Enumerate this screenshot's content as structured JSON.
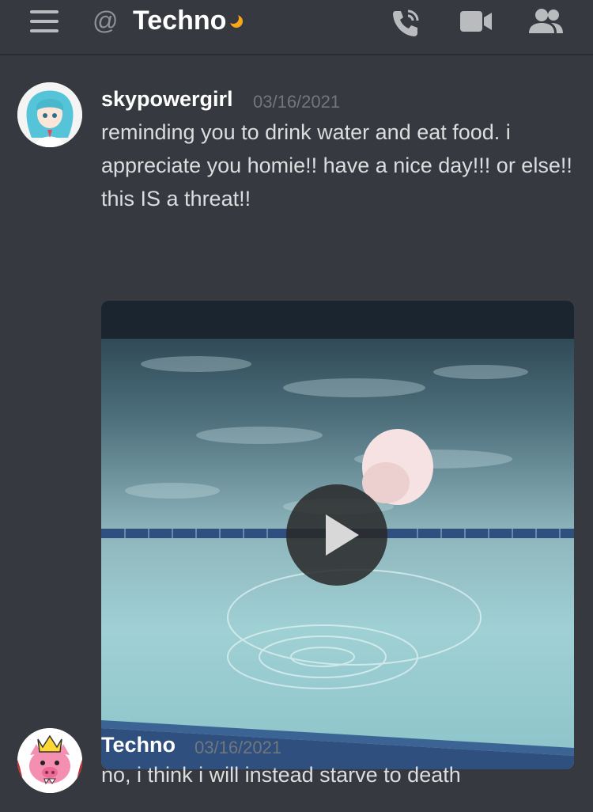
{
  "header": {
    "at_symbol": "@",
    "channel_name": "Techno",
    "icons": {
      "menu": "hamburger-menu-icon",
      "status": "moon-icon",
      "call": "phone-call-icon",
      "video": "video-camera-icon",
      "members": "members-icon"
    }
  },
  "messages": [
    {
      "username": "skypowergirl",
      "timestamp": "03/16/2021",
      "text": "reminding you to drink water and eat food. i appreciate you homie!! have a nice day!!! or else!! this IS a threat!!",
      "attachment": "video"
    },
    {
      "username": "Techno",
      "timestamp": "03/16/2021",
      "text": "no, i think i will instead starve to death"
    }
  ],
  "colors": {
    "background": "#36393f",
    "username": "#ffffff",
    "message_text": "#dcddde",
    "timestamp": "#72767d",
    "idle_status": "#faa61a"
  }
}
